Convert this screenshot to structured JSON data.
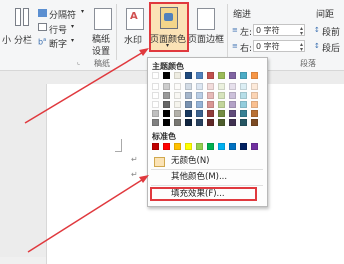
{
  "ribbon": {
    "small_label": "小",
    "columns_label": "分栏",
    "separator_label": "分隔符",
    "line_number_label": "行号",
    "hyphenation_label": "断字",
    "manuscript_label_1": "稿纸",
    "manuscript_label_2": "设置",
    "manuscript_group": "稿纸",
    "watermark_label": "水印",
    "page_color_label": "页面颜色",
    "page_border_label": "页面边框",
    "indent_label": "缩进",
    "indent_left_label": "左:",
    "indent_left_value": "0 字符",
    "indent_right_label": "右:",
    "indent_right_value": "0 字符",
    "spacing_label": "间距",
    "spacing_before_label": "段前",
    "spacing_after_label": "段后",
    "paragraph_group": "段落"
  },
  "popup": {
    "theme_colors_title": "主题颜色",
    "standard_colors_title": "标准色",
    "no_color_label": "无颜色(N)",
    "more_colors_label": "其他颜色(M)...",
    "fill_effects_label": "填充效果(F)..."
  },
  "colors": {
    "highlight_red": "#e0393e",
    "theme_top": [
      "#ffffff",
      "#000000",
      "#eeece1",
      "#1f497d",
      "#4f81bd",
      "#c0504d",
      "#9bbb59",
      "#8064a2",
      "#4bacc6",
      "#f79646"
    ],
    "standard": [
      "#c00000",
      "#ff0000",
      "#ffc000",
      "#ffff00",
      "#92d050",
      "#00b050",
      "#00b0f0",
      "#0070c0",
      "#002060",
      "#7030a0"
    ]
  }
}
